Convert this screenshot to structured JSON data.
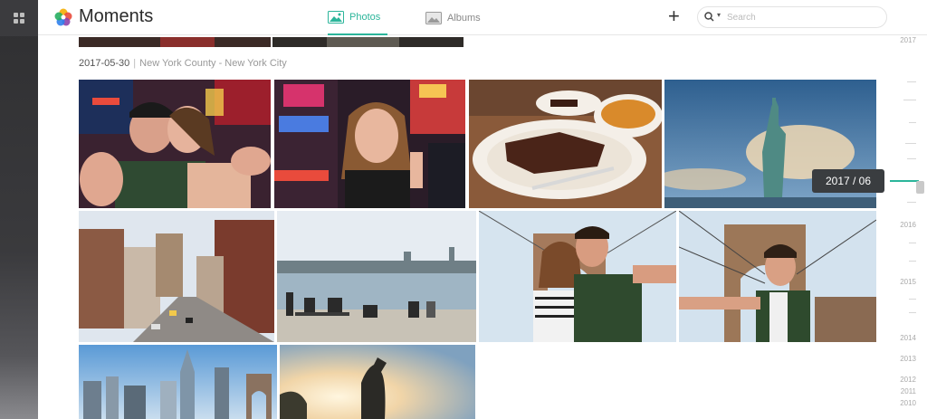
{
  "app": {
    "title": "Moments"
  },
  "tabs": [
    {
      "label": "Photos",
      "active": true
    },
    {
      "label": "Albums",
      "active": false
    }
  ],
  "search": {
    "placeholder": "Search"
  },
  "section": {
    "date": "2017-05-30",
    "location": "New York County - New York City"
  },
  "timeline": {
    "tooltip": "2017 / 06",
    "years": [
      "2017",
      "2016",
      "2015",
      "2014",
      "2013",
      "2012",
      "2011",
      "2010"
    ]
  },
  "photos": [
    {
      "name": "photo-friends-selfie-times-square"
    },
    {
      "name": "photo-woman-selfie-neon"
    },
    {
      "name": "photo-steak-dinner"
    },
    {
      "name": "photo-statue-of-liberty"
    },
    {
      "name": "photo-nyc-street"
    },
    {
      "name": "photo-waterfront-skyline"
    },
    {
      "name": "photo-couple-brooklyn-bridge"
    },
    {
      "name": "photo-man-brooklyn-bridge"
    },
    {
      "name": "photo-manhattan-skyline"
    },
    {
      "name": "photo-hiker-sunset"
    }
  ],
  "colors": {
    "accent": "#2bb59a",
    "rail": "#2f2f31"
  }
}
